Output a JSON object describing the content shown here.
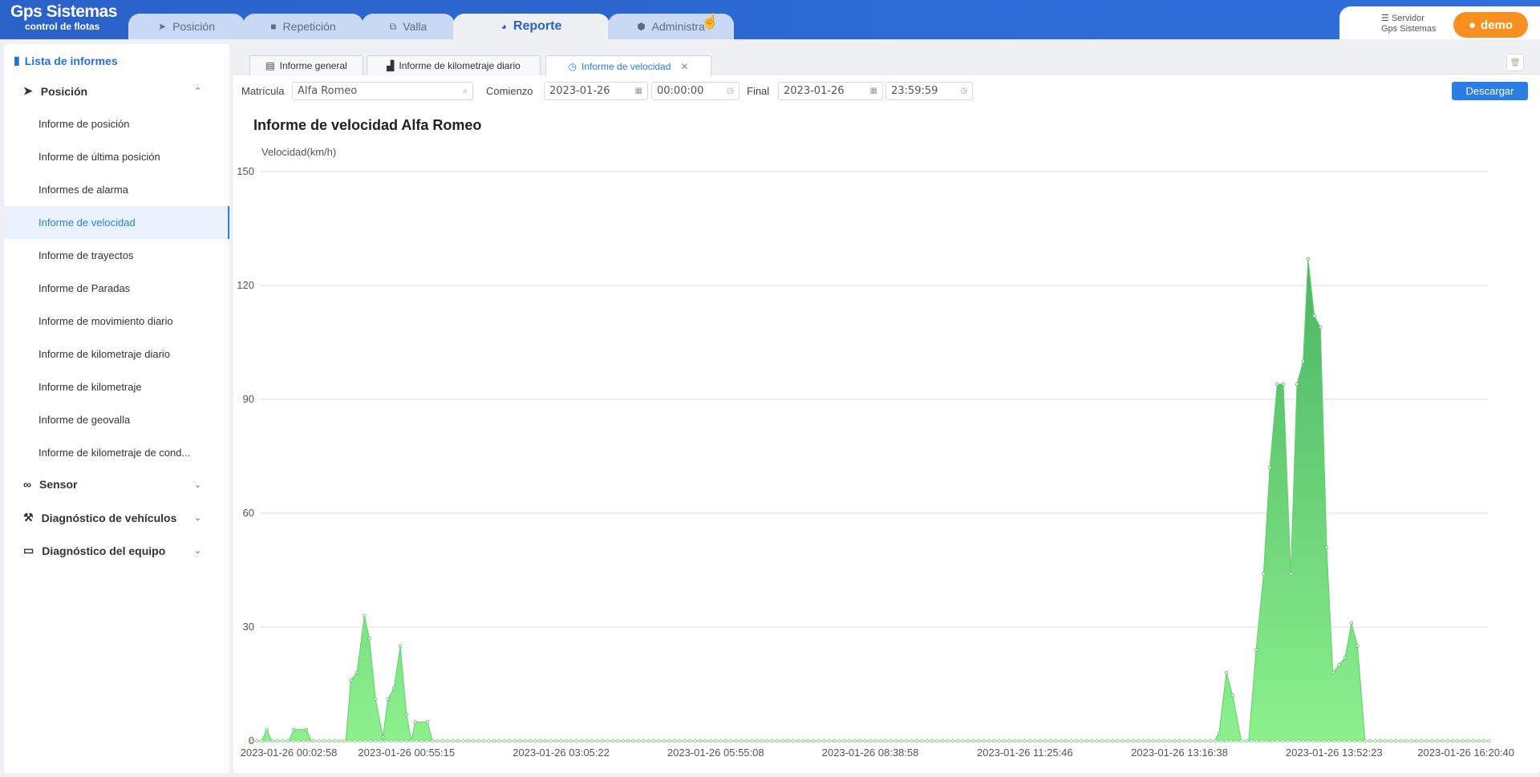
{
  "app": {
    "logo_line1": "Gps Sistemas",
    "logo_line2": "control de flotas"
  },
  "nav_tabs": [
    {
      "label": "Posición",
      "icon": "send-icon"
    },
    {
      "label": "Repetición",
      "icon": "video-icon"
    },
    {
      "label": "Valla",
      "icon": "fence-icon"
    },
    {
      "label": "Reporte",
      "icon": "pie-chart-icon",
      "active": true
    },
    {
      "label": "Administra",
      "icon": "cube-icon"
    }
  ],
  "header_right": {
    "server_line1": "Servidor",
    "server_line2": "Gps Sistemas",
    "user": "demo"
  },
  "sidebar": {
    "title": "Lista de informes",
    "groups": [
      {
        "label": "Posición",
        "expanded": true
      },
      {
        "label": "Sensor"
      },
      {
        "label": "Diagnóstico de vehículos"
      },
      {
        "label": "Diagnóstico del equipo"
      }
    ],
    "items": [
      "Informe de posición",
      "Informe de última posición",
      "Informes de alarma",
      "Informe de velocidad",
      "Informe de trayectos",
      "Informe de Paradas",
      "Informe de movimiento diario",
      "Informe de kilometraje diario",
      "Informe de kilometraje",
      "Informe de geovalla",
      "Informe de kilometraje de cond..."
    ],
    "active_item": "Informe de velocidad"
  },
  "report_tabs": [
    {
      "label": "Informe general",
      "icon": "clipboard-icon"
    },
    {
      "label": "Informe de kilometraje diario",
      "icon": "bar-chart-icon"
    },
    {
      "label": "Informe de velocidad",
      "icon": "clock-icon",
      "active": true,
      "closable": true
    }
  ],
  "filters": {
    "plate_label": "Matrícula",
    "plate_value": "Alfa Romeo",
    "start_label": "Comienzo",
    "start_date": "2023-01-26",
    "start_time": "00:00:00",
    "end_label": "Final",
    "end_date": "2023-01-26",
    "end_time": "23:59:59",
    "download": "Descargar"
  },
  "chart_title": "Informe de velocidad  Alfa Romeo",
  "chart_data": {
    "type": "area",
    "title": "Informe de velocidad  Alfa Romeo",
    "ylabel": "Velocidad(km/h)",
    "ylim": [
      0,
      150
    ],
    "yticks": [
      0,
      30,
      60,
      90,
      120,
      150
    ],
    "xticks": [
      "2023-01-26 00:02:58",
      "2023-01-26 00:55:15",
      "2023-01-26 03:05:22",
      "2023-01-26 05:55:08",
      "2023-01-26 08:38:58",
      "2023-01-26 11:25:46",
      "2023-01-26 13:16:38",
      "2023-01-26 13:52:23",
      "2023-01-26 16:20:40"
    ],
    "grid": true,
    "color": "#6fdc6f",
    "peaks": [
      [
        0.0,
        0
      ],
      [
        0.8,
        0
      ],
      [
        1.2,
        3
      ],
      [
        1.6,
        0
      ],
      [
        3.0,
        0
      ],
      [
        3.4,
        3
      ],
      [
        4.4,
        3
      ],
      [
        4.8,
        0
      ],
      [
        7.6,
        0
      ],
      [
        8.0,
        16
      ],
      [
        8.5,
        18
      ],
      [
        9.1,
        33
      ],
      [
        9.5,
        27
      ],
      [
        10.0,
        11
      ],
      [
        10.6,
        1
      ],
      [
        11.0,
        11
      ],
      [
        11.5,
        14
      ],
      [
        12.0,
        25
      ],
      [
        12.5,
        7
      ],
      [
        12.9,
        0
      ],
      [
        13.2,
        5
      ],
      [
        14.2,
        5
      ],
      [
        14.6,
        0
      ],
      [
        77.8,
        0
      ],
      [
        78.2,
        2
      ],
      [
        78.8,
        18
      ],
      [
        79.3,
        12
      ],
      [
        80.0,
        0
      ],
      [
        80.6,
        0
      ],
      [
        81.2,
        24
      ],
      [
        81.8,
        44
      ],
      [
        82.3,
        72
      ],
      [
        82.9,
        94
      ],
      [
        83.4,
        94
      ],
      [
        84.0,
        44
      ],
      [
        84.5,
        94
      ],
      [
        85.0,
        100
      ],
      [
        85.4,
        127
      ],
      [
        85.9,
        112
      ],
      [
        86.4,
        109
      ],
      [
        86.9,
        51
      ],
      [
        87.4,
        18
      ],
      [
        87.9,
        20
      ],
      [
        88.4,
        22
      ],
      [
        88.9,
        31
      ],
      [
        89.4,
        25
      ],
      [
        90.0,
        0
      ],
      [
        100.0,
        0
      ]
    ]
  }
}
